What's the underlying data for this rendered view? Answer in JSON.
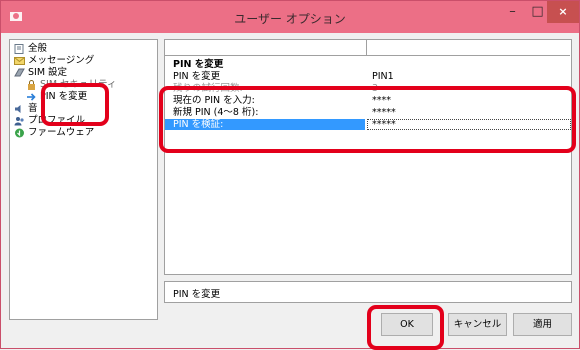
{
  "window": {
    "title": "ユーザー オプション",
    "minimize_glyph": "–",
    "maximize_glyph": "□",
    "close_glyph": "×"
  },
  "tree": {
    "items": [
      {
        "label": "全般",
        "icon": "general-icon"
      },
      {
        "label": "メッセージング",
        "icon": "envelope-icon"
      },
      {
        "label": "SIM 設定",
        "icon": "sim-settings-icon"
      },
      {
        "label": "SIM セキュリティ",
        "icon": "lock-icon"
      },
      {
        "label": "PIN を変更",
        "icon": "arrow-right-icon",
        "selected": true
      },
      {
        "label": "音",
        "icon": "speaker-icon"
      },
      {
        "label": "プロファイル",
        "icon": "profile-icon"
      },
      {
        "label": "ファームウェア",
        "icon": "firmware-icon"
      }
    ]
  },
  "panel": {
    "section_title": "PIN を変更",
    "rows": [
      {
        "label": "PIN を変更",
        "value": "PIN1"
      },
      {
        "label": "残りの試行回数:",
        "value": "3"
      },
      {
        "label": "現在の PIN を入力:",
        "value": "****"
      },
      {
        "label": "新規 PIN (4～8 桁):",
        "value": "*****"
      },
      {
        "label": "PIN を検証:",
        "value": "*****",
        "selected": true
      }
    ]
  },
  "status": {
    "text": "PIN を変更"
  },
  "buttons": {
    "ok": "OK",
    "cancel": "キャンセル",
    "apply": "適用"
  },
  "colors": {
    "titlebar": "#ec6f86",
    "selection": "#3399ff",
    "highlight": "#e3001b",
    "close": "#c75050"
  }
}
